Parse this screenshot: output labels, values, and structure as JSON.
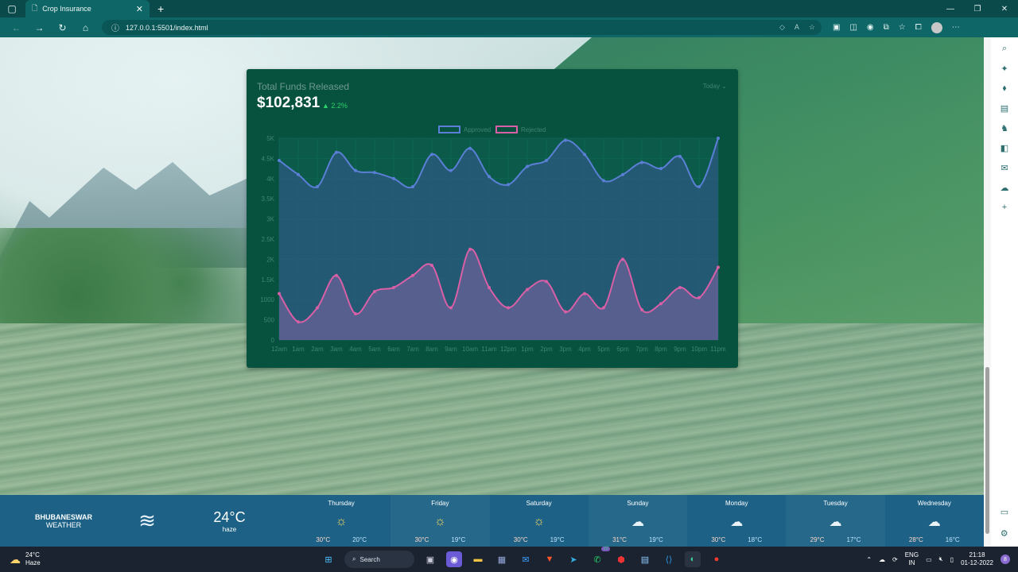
{
  "browser": {
    "tab_title": "Crop Insurance",
    "url": "127.0.0.1:5501/index.html"
  },
  "card": {
    "title": "Total Funds Released",
    "amount": "$102,831",
    "change": "▲ 2.2%",
    "period": "Today ⌄"
  },
  "chart_data": {
    "type": "area",
    "x": [
      "12am",
      "1am",
      "2am",
      "3am",
      "4am",
      "5am",
      "6am",
      "7am",
      "8am",
      "9am",
      "10am",
      "11am",
      "12pm",
      "1pm",
      "2pm",
      "3pm",
      "4pm",
      "5pm",
      "6pm",
      "7pm",
      "8pm",
      "9pm",
      "10pm",
      "11pm"
    ],
    "series": [
      {
        "name": "Approved",
        "color": "#5b7fd6",
        "values": [
          4450,
          4100,
          3800,
          4650,
          4200,
          4150,
          4000,
          3800,
          4600,
          4200,
          4750,
          4050,
          3850,
          4300,
          4450,
          4950,
          4600,
          3950,
          4100,
          4400,
          4250,
          4550,
          3800,
          5000
        ]
      },
      {
        "name": "Rejected",
        "color": "#d95fa6",
        "values": [
          1150,
          450,
          800,
          1600,
          650,
          1200,
          1300,
          1600,
          1850,
          800,
          2250,
          1300,
          800,
          1250,
          1450,
          700,
          1150,
          800,
          2000,
          750,
          900,
          1300,
          1050,
          1800
        ]
      }
    ],
    "yticks": [
      "0",
      "500",
      "1000",
      "1.5K",
      "2K",
      "2.5K",
      "3K",
      "3.5K",
      "4K",
      "4.5K",
      "5K"
    ],
    "ylim": [
      0,
      5000
    ],
    "legend": "top-center",
    "grid": true
  },
  "weather": {
    "city": "BHUBANESWAR",
    "label": "WEATHER",
    "current_temp": "24°C",
    "current_desc": "haze",
    "days": [
      {
        "day": "Thursday",
        "icon": "sun",
        "max": "30°C",
        "min": "20°C"
      },
      {
        "day": "Friday",
        "icon": "sun",
        "max": "30°C",
        "min": "19°C"
      },
      {
        "day": "Saturday",
        "icon": "sun",
        "max": "30°C",
        "min": "19°C"
      },
      {
        "day": "Sunday",
        "icon": "cloud",
        "max": "31°C",
        "min": "19°C"
      },
      {
        "day": "Monday",
        "icon": "cloud",
        "max": "30°C",
        "min": "18°C"
      },
      {
        "day": "Tuesday",
        "icon": "cloud",
        "max": "29°C",
        "min": "17°C"
      },
      {
        "day": "Wednesday",
        "icon": "cloud",
        "max": "28°C",
        "min": "16°C"
      }
    ]
  },
  "taskbar": {
    "weather_temp": "24°C",
    "weather_desc": "Haze",
    "search": "Search",
    "lang": "ENG",
    "region": "IN",
    "time": "21:18",
    "date": "01-12-2022",
    "notifications": "8",
    "whatsapp_badge": "10"
  }
}
